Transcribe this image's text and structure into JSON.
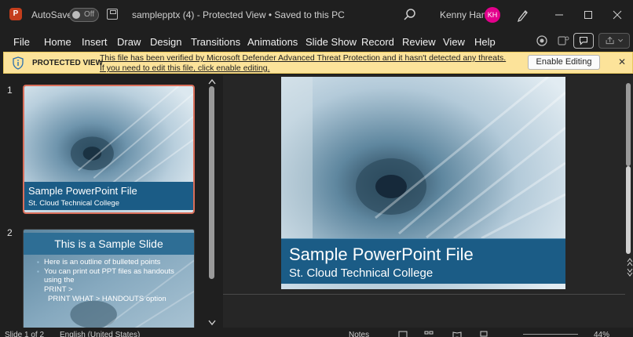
{
  "titlebar": {
    "app_logo": "P",
    "autosave_label": "AutoSave",
    "autosave_state": "Off",
    "document_title": "samplepptx (4)  -  Protected View • Saved to this PC",
    "user_name": "Kenny Han",
    "user_initials": "KH"
  },
  "menu": [
    {
      "label": "File"
    },
    {
      "label": "Home"
    },
    {
      "label": "Insert"
    },
    {
      "label": "Draw"
    },
    {
      "label": "Design"
    },
    {
      "label": "Transitions"
    },
    {
      "label": "Animations"
    },
    {
      "label": "Slide Show"
    },
    {
      "label": "Record"
    },
    {
      "label": "Review"
    },
    {
      "label": "View"
    },
    {
      "label": "Help"
    }
  ],
  "protected_view": {
    "title": "PROTECTED VIEW",
    "message": "This file has been verified by Microsoft Defender Advanced Threat Protection and it hasn't detected any threats. If you need to edit this file, click enable editing.",
    "enable_button": "Enable Editing",
    "close_glyph": "✕"
  },
  "thumbnails": [
    {
      "number": "1",
      "title": "Sample PowerPoint File",
      "subtitle": "St. Cloud Technical College"
    },
    {
      "number": "2",
      "title": "This is a Sample Slide",
      "bullets": [
        "Here is an outline of bulleted points",
        "You can print out PPT files as handouts using the"
      ],
      "lines": [
        "PRINT >",
        "PRINT WHAT > HANDOUTS option"
      ]
    }
  ],
  "main_slide": {
    "title": "Sample PowerPoint File",
    "subtitle": "St. Cloud Technical College"
  },
  "status": {
    "slide_counter": "Slide 1 of 2",
    "language": "English (United States)",
    "notes_label": "Notes",
    "zoom": "44%"
  },
  "colors": {
    "accent": "#c43e1c",
    "avatar": "#e3008c",
    "banner": "#1b5c86",
    "pv_bar": "#fce39a",
    "selected_thumb_border": "#d96e5a"
  }
}
